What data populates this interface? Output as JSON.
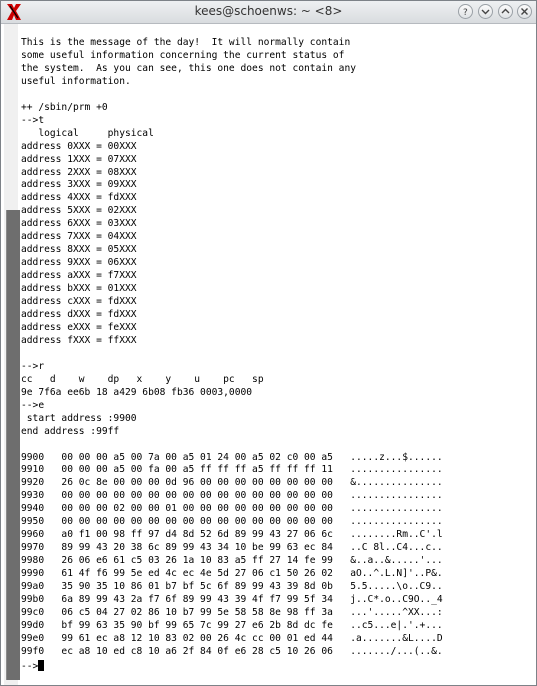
{
  "window": {
    "title": "kees@schoenws: ~ <8>"
  },
  "terminal": {
    "text": "This is the message of the day!  It will normally contain\nsome useful information concerning the current status of\nthe system.  As you can see, this one does not contain any\nuseful information.\n\n++ /sbin/prm +0\n-->t\n   logical     physical\naddress 0XXX = 00XXX\naddress 1XXX = 07XXX\naddress 2XXX = 08XXX\naddress 3XXX = 09XXX\naddress 4XXX = fdXXX\naddress 5XXX = 02XXX\naddress 6XXX = 03XXX\naddress 7XXX = 04XXX\naddress 8XXX = 05XXX\naddress 9XXX = 06XXX\naddress aXXX = f7XXX\naddress bXXX = 01XXX\naddress cXXX = fdXXX\naddress dXXX = fdXXX\naddress eXXX = feXXX\naddress fXXX = ffXXX\n\n-->r\ncc   d    w    dp   x    y    u    pc   sp\n9e 7f6a ee6b 18 a429 6b08 fb36 0003,0000\n-->e\n start address :9900\nend address :99ff\n\n9900   00 00 00 a5 00 7a 00 a5 01 24 00 a5 02 c0 00 a5   .....z...$......\n9910   00 00 00 a5 00 fa 00 a5 ff ff ff a5 ff ff ff 11   ................\n9920   26 0c 8e 00 00 00 0d 96 00 00 00 00 00 00 00 00   &...............\n9930   00 00 00 00 00 00 00 00 00 00 00 00 00 00 00 00   ................\n9940   00 00 00 02 00 00 01 00 00 00 00 00 00 00 00 00   ................\n9950   00 00 00 00 00 00 00 00 00 00 00 00 00 00 00 00   ................\n9960   a0 f1 00 98 ff 97 d4 8d 52 6d 89 99 43 27 06 6c   ........Rm..C'.l\n9970   89 99 43 20 38 6c 89 99 43 34 10 be 99 63 ec 84   ..C 8l..C4...c..\n9980   26 06 e6 61 c5 03 26 1a 10 83 a5 ff 27 14 fe 99   &..a..&.....'...\n9990   61 4f f6 99 5e ed 4c ec 4e 5d 27 06 c1 50 26 02   aO..^.L.N]'..P&.\n99a0   35 90 35 10 86 01 b7 bf 5c 6f 89 99 43 39 8d 0b   5.5.....\\o..C9..\n99b0   6a 89 99 43 2a f7 6f 89 99 43 39 4f f7 99 5f 34   j..C*.o..C9O.._4\n99c0   06 c5 04 27 02 86 10 b7 99 5e 58 58 8e 98 ff 3a   ...'.....^XX...:\n99d0   bf 99 63 35 90 bf 99 65 7c 99 27 e6 2b 8d dc fe   ..c5...e|.'.+...\n99e0   99 61 ec a8 12 10 83 02 00 26 4c cc 00 01 ed 44   .a.......&L....D\n99f0   ec a8 10 ed c8 10 a6 2f 84 0f e6 28 c5 10 26 06   ......./...(..&.",
    "prompt": "-->"
  },
  "icons": {
    "app": "xterm-x-icon",
    "help": "question-mark-icon",
    "minimize": "chevron-down-icon",
    "maximize": "chevron-up-icon",
    "close": "close-icon"
  },
  "colors": {
    "app_icon": "#cc0000"
  }
}
